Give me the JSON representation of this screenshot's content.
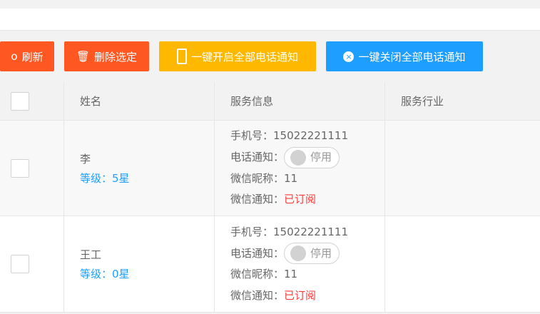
{
  "toolbar": {
    "refresh": "刷新",
    "delete": "删除选定",
    "enable_all": "一键开启全部电话通知",
    "disable_all": "一键关闭全部电话通知"
  },
  "colors": {
    "orange": "#ff5722",
    "yellow": "#ffb800",
    "blue": "#1e9fff"
  },
  "table": {
    "headers": [
      "姓名",
      "服务信息",
      "服务行业"
    ],
    "rows": [
      {
        "name": "李",
        "level": "等级：5星",
        "phone_label": "手机号：",
        "phone": "15022221111",
        "call_label": "电话通知：",
        "call_status": "停用",
        "wx_nick_label": "微信昵称：",
        "wx_nick": "11",
        "wx_notify_label": "微信通知：",
        "wx_notify": "已订阅"
      },
      {
        "name": "王工",
        "level": "等级：0星",
        "phone_label": "手机号：",
        "phone": "15022221111",
        "call_label": "电话通知：",
        "call_status": "停用",
        "wx_nick_label": "微信昵称：",
        "wx_nick": "11",
        "wx_notify_label": "微信通知：",
        "wx_notify": "已订阅"
      }
    ]
  }
}
